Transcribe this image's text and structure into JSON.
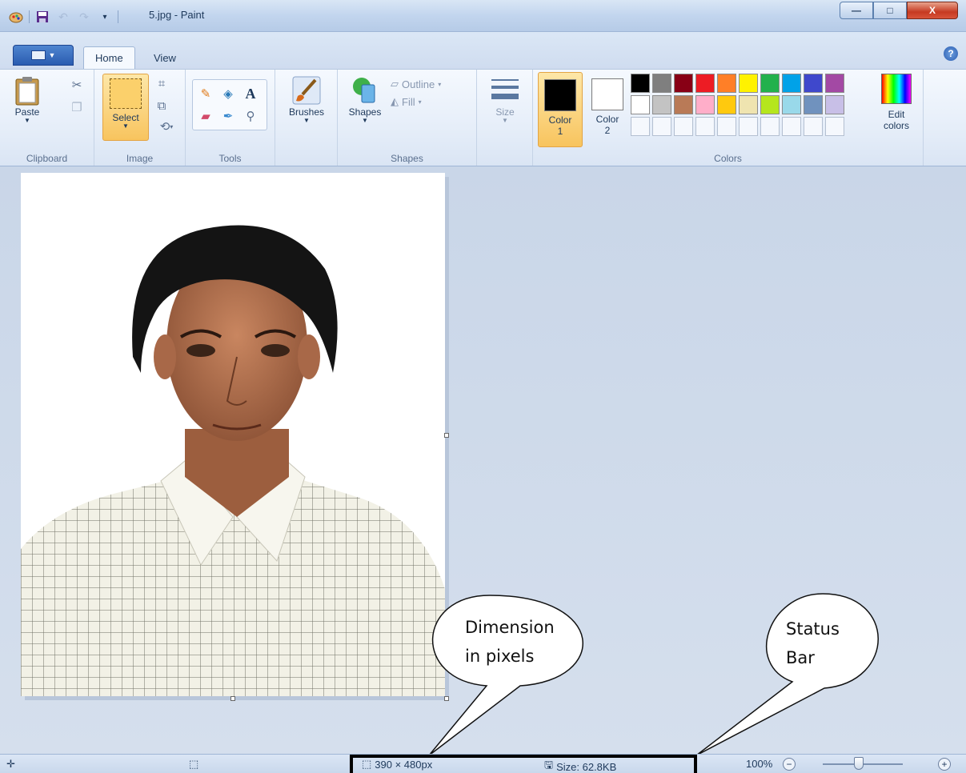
{
  "window": {
    "title": "5.jpg - Paint",
    "controls": {
      "minimize": "—",
      "maximize": "□",
      "close": "X"
    }
  },
  "quick_access": {
    "icons": [
      "paint-app-icon",
      "save-icon",
      "undo-icon",
      "redo-icon",
      "customize-dropdown-icon"
    ]
  },
  "ribbon": {
    "app_menu_label": "",
    "tabs": [
      {
        "label": "Home",
        "active": true
      },
      {
        "label": "View",
        "active": false
      }
    ],
    "help_label": "?",
    "groups": {
      "clipboard": {
        "label": "Clipboard",
        "paste": "Paste"
      },
      "image": {
        "label": "Image",
        "select": "Select"
      },
      "tools": {
        "label": "Tools"
      },
      "brushes": {
        "label": "Brushes"
      },
      "shapes": {
        "label": "Shapes",
        "shapes_btn": "Shapes",
        "outline": "Outline",
        "fill": "Fill"
      },
      "size": {
        "label": "Size"
      },
      "colors": {
        "label": "Colors",
        "color1_line1": "Color",
        "color1_line2": "1",
        "color2_line1": "Color",
        "color2_line2": "2",
        "edit_line1": "Edit",
        "edit_line2": "colors",
        "color1_value": "#000000",
        "color2_value": "#ffffff",
        "palette": [
          "#000000",
          "#7f7f7f",
          "#880015",
          "#ed1c24",
          "#ff7f27",
          "#fff200",
          "#22b14c",
          "#00a2e8",
          "#3f48cc",
          "#a349a4",
          "#ffffff",
          "#c3c3c3",
          "#b97a57",
          "#ffaec9",
          "#ffc90e",
          "#efe4b0",
          "#b5e61d",
          "#99d9ea",
          "#7092be",
          "#c8bfe7",
          "",
          "",
          "",
          "",
          "",
          "",
          "",
          "",
          "",
          ""
        ]
      }
    }
  },
  "callouts": {
    "dimension": {
      "line1": "Dimension",
      "line2": "in pixels"
    },
    "status": {
      "line1": "Status",
      "line2": "Bar"
    }
  },
  "statusbar": {
    "dimensions": "390 × 480px",
    "size": "Size: 62.8KB",
    "zoom": "100%",
    "zoom_level_fraction": 0.45
  }
}
